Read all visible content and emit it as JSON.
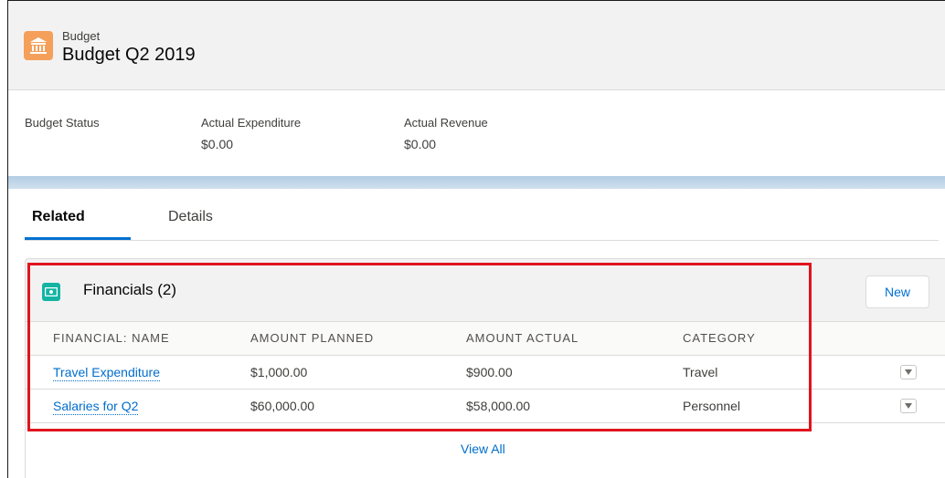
{
  "header": {
    "object_type": "Budget",
    "record_name": "Budget Q2 2019",
    "icon": "bank-icon"
  },
  "highlights": [
    {
      "label": "Budget Status",
      "value": ""
    },
    {
      "label": "Actual Expenditure",
      "value": "$0.00"
    },
    {
      "label": "Actual Revenue",
      "value": "$0.00"
    }
  ],
  "tabs": [
    {
      "label": "Related",
      "active": true
    },
    {
      "label": "Details",
      "active": false
    }
  ],
  "related_list": {
    "title": "Financials (2)",
    "icon": "money-icon",
    "new_label": "New",
    "columns": [
      "FINANCIAL: NAME",
      "AMOUNT PLANNED",
      "AMOUNT ACTUAL",
      "CATEGORY"
    ],
    "rows": [
      [
        "Travel Expenditure",
        "$1,000.00",
        "$900.00",
        "Travel"
      ],
      [
        "Salaries for Q2",
        "$60,000.00",
        "$58,000.00",
        "Personnel"
      ]
    ],
    "view_all_label": "View All"
  },
  "colors": {
    "accent": "#0070d2",
    "budget_icon": "#f4a05a",
    "financial_icon": "#13b4a3",
    "highlight_box": "#e0141e"
  }
}
